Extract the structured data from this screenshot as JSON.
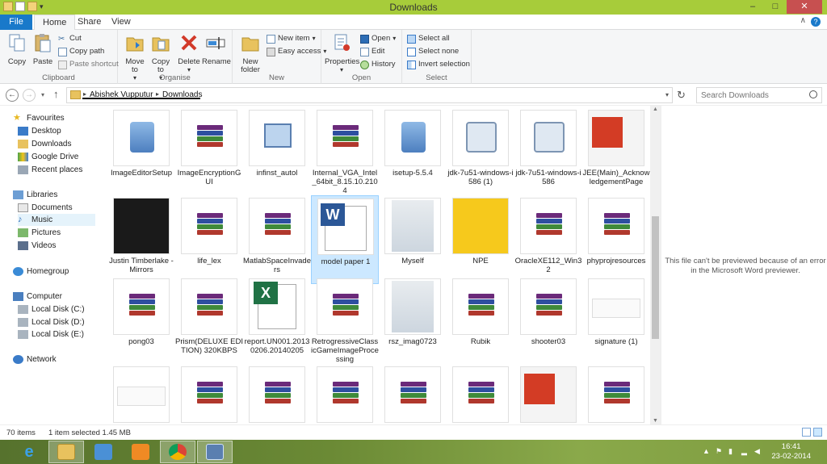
{
  "window": {
    "title": "Downloads",
    "minimize": "–",
    "maximize": "□",
    "close": "✕"
  },
  "tabs": {
    "file": "File",
    "home": "Home",
    "share": "Share",
    "view": "View"
  },
  "ribbon": {
    "clipboard": {
      "label": "Clipboard",
      "copy": "Copy",
      "paste": "Paste",
      "cut": "Cut",
      "copy_path": "Copy path",
      "paste_shortcut": "Paste shortcut"
    },
    "organise": {
      "label": "Organise",
      "move_to": "Move to",
      "copy_to": "Copy to",
      "delete": "Delete",
      "rename": "Rename"
    },
    "new": {
      "label": "New",
      "new_folder": "New folder",
      "new_item": "New item",
      "easy_access": "Easy access"
    },
    "open": {
      "label": "Open",
      "properties": "Properties",
      "open": "Open",
      "edit": "Edit",
      "history": "History"
    },
    "select": {
      "label": "Select",
      "select_all": "Select all",
      "select_none": "Select none",
      "invert": "Invert selection"
    }
  },
  "address": {
    "crumbs": [
      "Abishek Vupputur",
      "Downloads"
    ],
    "search_placeholder": "Search Downloads"
  },
  "nav": {
    "favourites": "Favourites",
    "desktop": "Desktop",
    "downloads": "Downloads",
    "google_drive": "Google Drive",
    "recent": "Recent places",
    "libraries": "Libraries",
    "documents": "Documents",
    "music": "Music",
    "pictures": "Pictures",
    "videos": "Videos",
    "homegroup": "Homegroup",
    "computer": "Computer",
    "disk_c": "Local Disk (C:)",
    "disk_d": "Local Disk (D:)",
    "disk_e": "Local Disk (E:)",
    "network": "Network"
  },
  "files": [
    {
      "name": "ImageEditorSetup",
      "icon": "installer-icon"
    },
    {
      "name": "ImageEncryptionGUI",
      "icon": "winrar-archive-icon"
    },
    {
      "name": "infinst_autol",
      "icon": "setup-icon"
    },
    {
      "name": "Internal_VGA_Intel_64bit_8.15.10.2104",
      "icon": "winrar-archive-icon"
    },
    {
      "name": "isetup-5.5.4",
      "icon": "installer-icon"
    },
    {
      "name": "jdk-7u51-windows-i586 (1)",
      "icon": "java-installer-icon"
    },
    {
      "name": "jdk-7u51-windows-i586",
      "icon": "java-installer-icon"
    },
    {
      "name": "JEE(Main)_AcknowledgementPage",
      "icon": "pdf-icon"
    },
    {
      "name": "Justin Timberlake - Mirrors",
      "icon": "album-art-icon"
    },
    {
      "name": "life_lex",
      "icon": "winrar-archive-icon"
    },
    {
      "name": "MatlabSpaceInvaders",
      "icon": "winrar-archive-icon"
    },
    {
      "name": "model paper 1",
      "icon": "word-document-icon"
    },
    {
      "name": "Myself",
      "icon": "photo-icon"
    },
    {
      "name": "NPE",
      "icon": "npe-icon"
    },
    {
      "name": "OracleXE112_Win32",
      "icon": "winrar-archive-icon"
    },
    {
      "name": "phyprojresources",
      "icon": "winrar-archive-icon"
    },
    {
      "name": "pong03",
      "icon": "winrar-archive-icon"
    },
    {
      "name": "Prism(DELUXE EDITION) 320KBPS",
      "icon": "winrar-archive-icon"
    },
    {
      "name": "report.UN001.20130206.20140205",
      "icon": "excel-icon"
    },
    {
      "name": "RetrogressiveClassicGameImageProcessing",
      "icon": "winrar-archive-icon"
    },
    {
      "name": "rsz_imag0723",
      "icon": "photo-icon"
    },
    {
      "name": "Rubik",
      "icon": "winrar-archive-icon"
    },
    {
      "name": "shooter03",
      "icon": "winrar-archive-icon"
    },
    {
      "name": "signature (1)",
      "icon": "signature-image-icon"
    },
    {
      "name": "",
      "icon": "signature-image-icon"
    },
    {
      "name": "",
      "icon": "winrar-archive-icon"
    },
    {
      "name": "",
      "icon": "winrar-archive-icon"
    },
    {
      "name": "",
      "icon": "winrar-archive-icon"
    },
    {
      "name": "",
      "icon": "winrar-archive-icon"
    },
    {
      "name": "",
      "icon": "winrar-archive-icon"
    },
    {
      "name": "",
      "icon": "pdf-icon"
    },
    {
      "name": "",
      "icon": "winrar-archive-icon"
    }
  ],
  "selected_file": "model paper 1",
  "preview_message": "This file can't be previewed because of an error in the Microsoft Word previewer.",
  "status": {
    "count": "70 items",
    "selection": "1 item selected  1.45 MB"
  },
  "taskbar": {
    "time": "16:41",
    "date": "23-02-2014"
  },
  "colors": {
    "accent": "#1979ca",
    "titlebar": "#a7cc3a",
    "selection": "#cce8ff"
  }
}
